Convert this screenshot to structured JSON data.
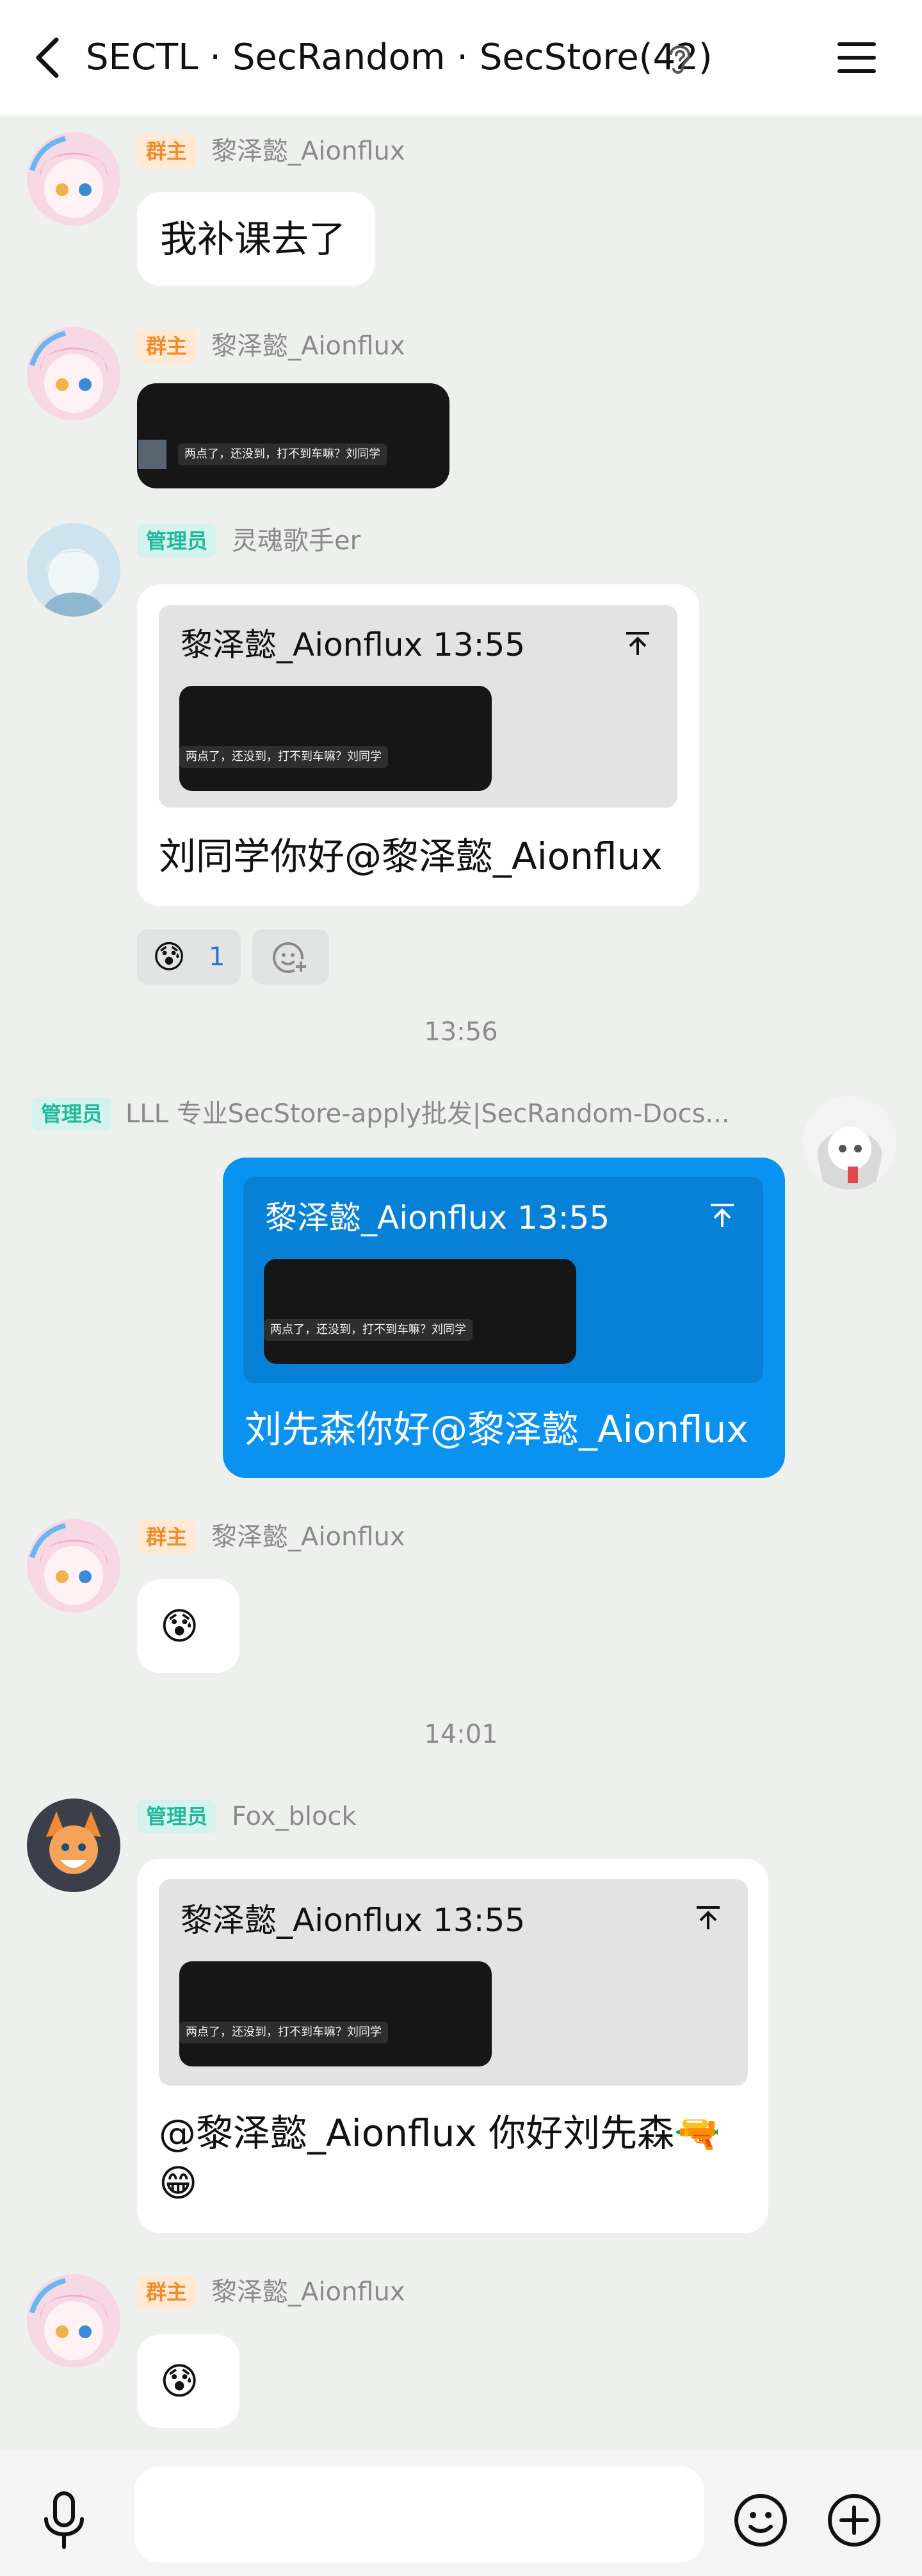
{
  "header": {
    "title": "SECTL · SecRandom · SecStore(42)",
    "back_icon": "chevron-left-icon",
    "ear_icon": "ear-icon",
    "menu_icon": "hamburger-menu-icon"
  },
  "badges": {
    "owner": "群主",
    "admin": "管理员"
  },
  "messages": [
    {
      "sender": "黎泽懿_Aionflux",
      "role": "群主",
      "text": "我补课去了"
    },
    {
      "sender": "黎泽懿_Aionflux",
      "role": "群主",
      "image_caption": "两点了，还没到，打不到车嘛？刘同学"
    },
    {
      "sender": "灵魂歌手er",
      "role": "管理员",
      "quote": {
        "header": "黎泽懿_Aionflux 13:55",
        "image_caption": "两点了，还没到，打不到车嘛？刘同学"
      },
      "text": "刘同学你好@黎泽懿_Aionflux",
      "reaction": {
        "emoji": "😰",
        "count": "1"
      }
    },
    {
      "sender": "LLL 专业SecStore-apply批发|SecRandom-Docs...",
      "role": "管理员",
      "quote": {
        "header": "黎泽懿_Aionflux 13:55",
        "image_caption": "两点了，还没到，打不到车嘛？刘同学"
      },
      "text": "刘先森你好@黎泽懿_Aionflux"
    },
    {
      "sender": "黎泽懿_Aionflux",
      "role": "群主",
      "text": "😰"
    },
    {
      "sender": "Fox_block",
      "role": "管理员",
      "quote": {
        "header": "黎泽懿_Aionflux 13:55",
        "image_caption": "两点了，还没到，打不到车嘛？刘同学"
      },
      "text_line1": "@黎泽懿_Aionflux 你好刘先森🔫",
      "text_line2": "😁"
    },
    {
      "sender": "黎泽懿_Aionflux",
      "role": "群主",
      "text": "😰"
    }
  ],
  "time_separators": [
    "13:56",
    "14:01"
  ],
  "input": {
    "placeholder": ""
  },
  "colors": {
    "background": "#eef0ee",
    "my_bubble": "#0a92f0",
    "owner_badge": "#f08a2b",
    "admin_badge": "#1fb89a"
  }
}
